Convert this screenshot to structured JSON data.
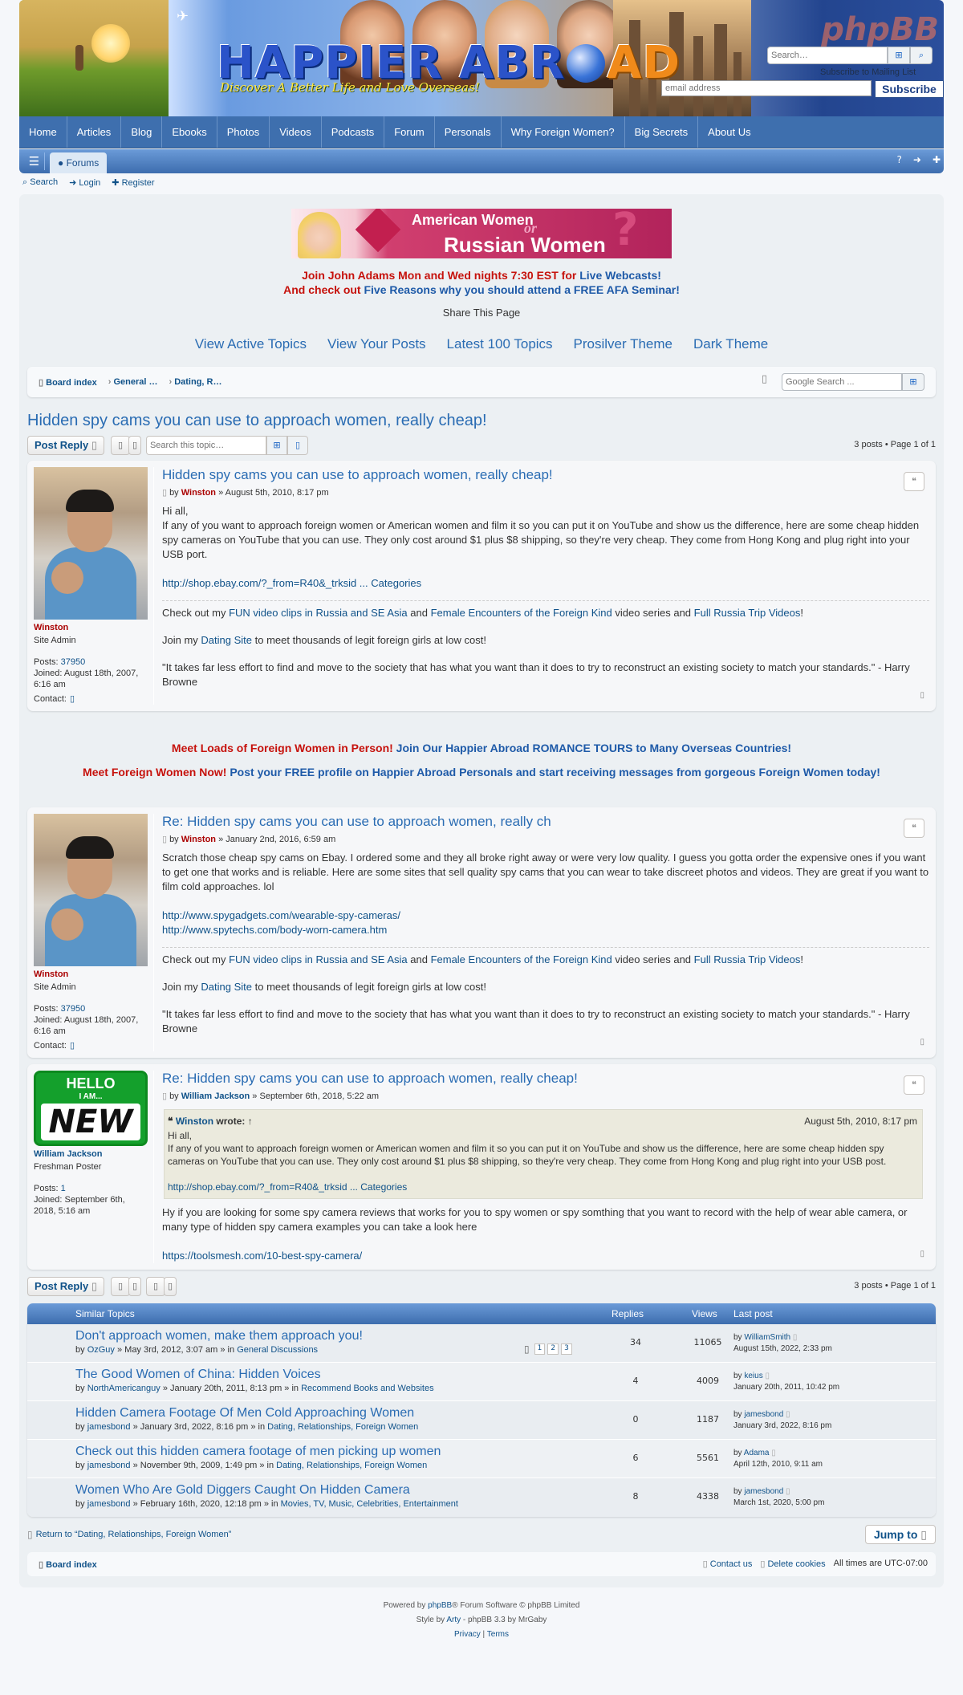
{
  "header": {
    "title_part1": "HAPPIER ABR",
    "title_part2": "AD",
    "tagline": "Discover A Better Life and Love Overseas!",
    "phpbb_logo": "phpBB",
    "search_placeholder": "Search…",
    "mailing_label": "Subscribe to Mailing List",
    "email_placeholder": "email address",
    "subscribe_label": "Subscribe"
  },
  "main_nav": [
    "Home",
    "Articles",
    "Blog",
    "Ebooks",
    "Photos",
    "Videos",
    "Podcasts",
    "Forum",
    "Personals",
    "Why Foreign Women?",
    "Big Secrets",
    "About Us"
  ],
  "sub_nav": {
    "forums_tab": "Forums"
  },
  "quick_links": [
    "Search",
    "Login",
    "Register"
  ],
  "ad_banner": {
    "line1": "American Women",
    "line2": "or",
    "line3": "Russian Women",
    "mark": "?"
  },
  "promo": {
    "line1_red": "Join John Adams Mon and Wed nights 7:30 EST for ",
    "line1_blue": "Live Webcasts!",
    "line2_red": "And check out ",
    "line2_blue": "Five Reasons why you should attend a FREE AFA Seminar!"
  },
  "share_text": "Share This Page",
  "top_links": [
    "View Active Topics",
    "View Your Posts",
    "Latest 100 Topics",
    "Prosilver Theme",
    "Dark Theme"
  ],
  "breadcrumb": [
    "Board index",
    "General …",
    "Dating, R…"
  ],
  "google_search_placeholder": "Google Search ...",
  "topic_title": "Hidden spy cams you can use to approach women, really cheap!",
  "action": {
    "post_reply": "Post Reply",
    "search_topic_placeholder": "Search this topic…",
    "pagination": "3 posts • Page 1 of 1"
  },
  "posts": [
    {
      "title": "Hidden spy cams you can use to approach women, really cheap!",
      "author": "Winston",
      "date": "August 5th, 2010, 8:17 pm",
      "rank": "Site Admin",
      "posts_label": "Posts: ",
      "posts_count": "37950",
      "joined": "Joined: August 18th, 2007, 6:16 am",
      "contact": "Contact:",
      "body": [
        "Hi all,",
        "If any of you want to approach foreign women or American women and film it so you can put it on YouTube and show us the difference, here are some cheap hidden spy cameras on YouTube that you can use. They only cost around $1 plus $8 shipping, so they're very cheap. They come from Hong Kong and plug right into your USB port."
      ],
      "link": "http://shop.ebay.com/?_from=R40&_trksid ... Categories"
    },
    {
      "title": "Re: Hidden spy cams you can use to approach women, really ch",
      "author": "Winston",
      "date": "January 2nd, 2016, 6:59 am",
      "rank": "Site Admin",
      "posts_label": "Posts: ",
      "posts_count": "37950",
      "joined": "Joined: August 18th, 2007, 6:16 am",
      "contact": "Contact:",
      "body": [
        "Scratch those cheap spy cams on Ebay. I ordered some and they all broke right away or were very low quality. I guess you gotta order the expensive ones if you want to get one that works and is reliable. Here are some sites that sell quality spy cams that you can wear to take discreet photos and videos. They are great if you want to film cold approaches. lol"
      ],
      "link1": "http://www.spygadgets.com/wearable-spy-cameras/",
      "link2": "http://www.spytechs.com/body-worn-camera.htm"
    },
    {
      "title": "Re: Hidden spy cams you can use to approach women, really cheap!",
      "author": "William Jackson",
      "date": "September 6th, 2018, 5:22 am",
      "rank": "Freshman Poster",
      "posts_label": "Posts: ",
      "posts_count": "1",
      "joined": "Joined: September 6th, 2018, 5:16 am",
      "avatar_hello": "HELLO",
      "avatar_iam": "I AM...",
      "avatar_new": "NEW",
      "quote_author": "Winston",
      "quote_wrote": " wrote: ↑",
      "quote_date": "August 5th, 2010, 8:17 pm",
      "quote_hi": "Hi all,",
      "quote_body": "If any of you want to approach foreign women or American women and film it so you can put it on YouTube and show us the difference, here are some cheap hidden spy cameras on YouTube that you can use. They only cost around $1 plus $8 shipping, so they're very cheap. They come from Hong Kong and plug right into your USB post.",
      "quote_link": "http://shop.ebay.com/?_from=R40&_trksid ... Categories",
      "body": "Hy if you are looking for some spy camera reviews that works for you to spy women or spy somthing that you want to record with the help of wear able camera, or many type of hidden spy camera examples you can take a look here",
      "link": "https://toolsmesh.com/10-best-spy-camera/"
    }
  ],
  "signature": {
    "s1_a": "Check out my ",
    "s1_l1": "FUN video clips in Russia and SE Asia",
    "s1_b": " and ",
    "s1_l2": "Female Encounters of the Foreign Kind",
    "s1_c": " video series and ",
    "s1_l3": "Full Russia Trip Videos",
    "s1_d": "!",
    "s2_a": "Join my ",
    "s2_l": "Dating Site",
    "s2_b": " to meet thousands of legit foreign girls at low cost!",
    "s3": "\"It takes far less effort to find and move to the society that has what you want than it does to try to reconstruct an existing society to match your standards.\" - Harry Browne"
  },
  "promo_mid": {
    "l1_red": "Meet Loads of Foreign Women in Person! ",
    "l1_blue": "Join Our Happier Abroad ROMANCE TOURS to Many Overseas Countries!",
    "l2_red": "Meet Foreign Women Now! ",
    "l2_blue": "Post your FREE profile on Happier Abroad Personals and start receiving messages from gorgeous Foreign Women today!"
  },
  "similar": {
    "header": {
      "topics": "Similar Topics",
      "replies": "Replies",
      "views": "Views",
      "last": "Last post"
    },
    "rows": [
      {
        "title": "Don't approach women, make them approach you!",
        "by": "OzGuy",
        "date": " » May 3rd, 2012, 3:07 am » in ",
        "forum": "General Discussions",
        "replies": "34",
        "views": "11065",
        "last_by": "WilliamSmith",
        "last_date": "August 15th, 2022, 2:33 pm",
        "pages": [
          "1",
          "2",
          "3"
        ]
      },
      {
        "title": "The Good Women of China: Hidden Voices",
        "by": "NorthAmericanguy",
        "date": " » January 20th, 2011, 8:13 pm » in ",
        "forum": "Recommend Books and Websites",
        "replies": "4",
        "views": "4009",
        "last_by": "keius",
        "last_date": "January 20th, 2011, 10:42 pm"
      },
      {
        "title": "Hidden Camera Footage Of Men Cold Approaching Women",
        "by": "jamesbond",
        "date": " » January 3rd, 2022, 8:16 pm » in ",
        "forum": "Dating, Relationships, Foreign Women",
        "replies": "0",
        "views": "1187",
        "last_by": "jamesbond",
        "last_date": "January 3rd, 2022, 8:16 pm"
      },
      {
        "title": "Check out this hidden camera footage of men picking up women",
        "by": "jamesbond",
        "date": " » November 9th, 2009, 1:49 pm » in ",
        "forum": "Dating, Relationships, Foreign Women",
        "replies": "6",
        "views": "5561",
        "last_by": "Adama",
        "last_date": "April 12th, 2010, 9:11 am"
      },
      {
        "title": "Women Who Are Gold Diggers Caught On Hidden Camera",
        "by": "jamesbond",
        "date": " » February 16th, 2020, 12:18 pm » in ",
        "forum": "Movies, TV, Music, Celebrities, Entertainment",
        "replies": "8",
        "views": "4338",
        "last_by": "jamesbond",
        "last_date": "March 1st, 2020, 5:00 pm"
      }
    ]
  },
  "return_link": "Return to “Dating, Relationships, Foreign Women”",
  "jump_to": "Jump to",
  "footer": {
    "board_index": "Board index",
    "contact": "Contact us",
    "delete_cookies": "Delete cookies",
    "timezone": "All times are UTC-07:00",
    "powered_a": "Powered by ",
    "powered_l": "phpBB",
    "powered_b": "® Forum Software © phpBB Limited",
    "style_a": "Style by ",
    "style_l": "Arty",
    "style_b": " - phpBB 3.3 by MrGaby",
    "privacy": "Privacy",
    "sep": " | ",
    "terms": "Terms"
  },
  "colors": {
    "nav": "#3e6fae",
    "link": "#105289",
    "admin": "#aa0000",
    "promo_red": "#c6120c"
  },
  "icons": [
    "search-icon",
    "login-icon",
    "register-icon",
    "bars-icon",
    "comment-icon",
    "question-icon",
    "user-plus-icon",
    "share-icon",
    "quote-icon",
    "wrench-icon",
    "bookmark-icon",
    "arrow-up-icon",
    "home-icon",
    "envelope-icon",
    "trash-icon",
    "file-icon",
    "chevron-right-icon"
  ]
}
